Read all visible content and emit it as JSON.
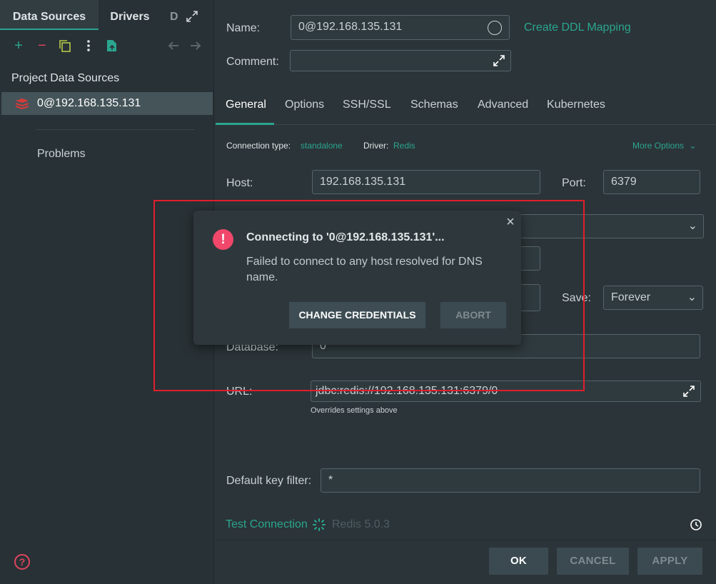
{
  "left_panel": {
    "tabs": [
      "Data Sources",
      "Drivers",
      "D"
    ],
    "toolbar_icons": [
      "add-icon",
      "remove-icon",
      "copy-icon",
      "more-icon",
      "export-icon",
      "back-icon",
      "forward-icon"
    ],
    "section_title": "Project Data Sources",
    "items": [
      {
        "label": "0@192.168.135.131",
        "icon": "redis-icon"
      }
    ],
    "problems": "Problems",
    "help": "?"
  },
  "form": {
    "name_label": "Name:",
    "name_value": "0@192.168.135.131",
    "ddl_link": "Create DDL Mapping",
    "comment_label": "Comment:",
    "comment_value": "",
    "tabs": [
      "General",
      "Options",
      "SSH/SSL",
      "Schemas",
      "Advanced",
      "Kubernetes"
    ],
    "connection_type_label": "Connection type:",
    "connection_type_value": "standalone",
    "driver_label": "Driver:",
    "driver_value": "Redis",
    "more_options": "More Options",
    "host_label": "Host:",
    "host_value": "192.168.135.131",
    "port_label": "Port:",
    "port_value": "6379",
    "save_label": "Save:",
    "save_value": "Forever",
    "database_label": "Database:",
    "database_value": "0",
    "url_label": "URL:",
    "url_value": "jdbc:redis://192.168.135.131:6379/0",
    "url_hint": "Overrides settings above",
    "key_filter_label": "Default key filter:",
    "key_filter_value": "*",
    "test_connection": "Test Connection",
    "redis_version": "Redis 5.0.3"
  },
  "dialog": {
    "title": "Connecting to '0@192.168.135.131'...",
    "message": "Failed to connect to any host resolved for DNS name.",
    "change_credentials": "CHANGE CREDENTIALS",
    "abort": "ABORT"
  },
  "buttons": {
    "ok": "OK",
    "cancel": "CANCEL",
    "apply": "APPLY"
  },
  "colors": {
    "accent": "#2aa58f",
    "error": "#f0476a",
    "highlight_box": "#e01e2d",
    "background": "#2b3438"
  }
}
